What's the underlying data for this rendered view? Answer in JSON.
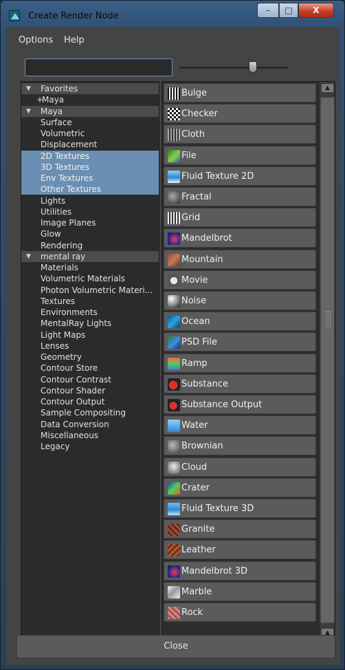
{
  "window": {
    "title": "Create Render Node",
    "controls": {
      "minimize": "–",
      "maximize": "□",
      "close": "X"
    }
  },
  "menu": {
    "options": "Options",
    "help": "Help"
  },
  "search": {
    "value": ""
  },
  "slider": {
    "position": 0.68
  },
  "tree": [
    {
      "label": "Favorites",
      "kind": "header",
      "expanded": true
    },
    {
      "label": "Maya",
      "kind": "favorite"
    },
    {
      "label": "Maya",
      "kind": "header",
      "expanded": true
    },
    {
      "label": "Surface"
    },
    {
      "label": "Volumetric"
    },
    {
      "label": "Displacement"
    },
    {
      "label": "2D Textures",
      "selected": true
    },
    {
      "label": "3D Textures",
      "selected": true
    },
    {
      "label": "Env Textures",
      "selected": true
    },
    {
      "label": "Other Textures",
      "selected": true
    },
    {
      "label": "Lights"
    },
    {
      "label": "Utilities"
    },
    {
      "label": "Image Planes"
    },
    {
      "label": "Glow"
    },
    {
      "label": "Rendering"
    },
    {
      "label": "mental ray",
      "kind": "header",
      "expanded": true
    },
    {
      "label": "Materials"
    },
    {
      "label": "Volumetric Materials"
    },
    {
      "label": "Photon Volumetric Materi..."
    },
    {
      "label": "Textures"
    },
    {
      "label": "Environments"
    },
    {
      "label": "MentalRay Lights"
    },
    {
      "label": "Light Maps"
    },
    {
      "label": "Lenses"
    },
    {
      "label": "Geometry"
    },
    {
      "label": "Contour Store"
    },
    {
      "label": "Contour Contrast"
    },
    {
      "label": "Contour Shader"
    },
    {
      "label": "Contour Output"
    },
    {
      "label": "Sample Compositing"
    },
    {
      "label": "Data Conversion"
    },
    {
      "label": "Miscellaneous"
    },
    {
      "label": "Legacy"
    }
  ],
  "nodes": [
    {
      "label": "Bulge",
      "icon": "bulge-icon"
    },
    {
      "label": "Checker",
      "icon": "checker-icon"
    },
    {
      "label": "Cloth",
      "icon": "cloth-icon"
    },
    {
      "label": "File",
      "icon": "file-icon"
    },
    {
      "label": "Fluid Texture 2D",
      "icon": "fluid-texture-2d-icon"
    },
    {
      "label": "Fractal",
      "icon": "fractal-icon"
    },
    {
      "label": "Grid",
      "icon": "grid-icon"
    },
    {
      "label": "Mandelbrot",
      "icon": "mandelbrot-icon"
    },
    {
      "label": "Mountain",
      "icon": "mountain-icon"
    },
    {
      "label": "Movie",
      "icon": "movie-icon"
    },
    {
      "label": "Noise",
      "icon": "noise-icon"
    },
    {
      "label": "Ocean",
      "icon": "ocean-icon"
    },
    {
      "label": "PSD File",
      "icon": "psd-file-icon"
    },
    {
      "label": "Ramp",
      "icon": "ramp-icon"
    },
    {
      "label": "Substance",
      "icon": "substance-icon"
    },
    {
      "label": "Substance Output",
      "icon": "substance-output-icon"
    },
    {
      "label": "Water",
      "icon": "water-icon"
    },
    {
      "label": "Brownian",
      "icon": "brownian-icon"
    },
    {
      "label": "Cloud",
      "icon": "cloud-icon"
    },
    {
      "label": "Crater",
      "icon": "crater-icon"
    },
    {
      "label": "Fluid Texture 3D",
      "icon": "fluid-texture-3d-icon"
    },
    {
      "label": "Granite",
      "icon": "granite-icon"
    },
    {
      "label": "Leather",
      "icon": "leather-icon"
    },
    {
      "label": "Mandelbrot 3D",
      "icon": "mandelbrot-3d-icon"
    },
    {
      "label": "Marble",
      "icon": "marble-icon"
    },
    {
      "label": "Rock",
      "icon": "rock-icon"
    }
  ],
  "footer": {
    "close": "Close"
  }
}
